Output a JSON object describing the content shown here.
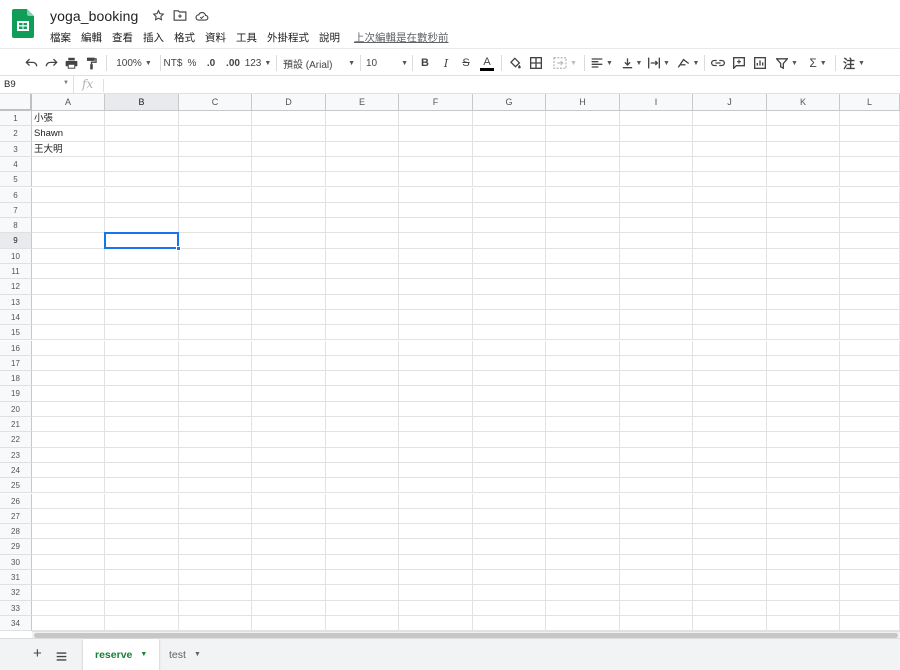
{
  "app": {
    "doc_title": "yoga_booking",
    "brand_color": "#0f9d58",
    "accent_color": "#1a73e8"
  },
  "header": {
    "icons": [
      "star-icon",
      "move-to-folder-icon",
      "cloud-status-icon"
    ],
    "menus": [
      "檔案",
      "編輯",
      "查看",
      "插入",
      "格式",
      "資料",
      "工具",
      "外掛程式",
      "說明"
    ],
    "last_edit": "上次編輯是在數秒前"
  },
  "toolbar": {
    "zoom": "100%",
    "currency": "NT$",
    "percent": "%",
    "decrease_decimal": ".0",
    "increase_decimal": ".00",
    "more_formats": "123",
    "font": "預設 (Arial)",
    "font_size": "10",
    "bold": "B",
    "italic": "I",
    "strike": "S",
    "text_color": "A",
    "sum": "Σ",
    "input_tools": "注"
  },
  "formula_bar": {
    "name_box": "B9",
    "fx": "fx",
    "value": ""
  },
  "grid": {
    "columns": [
      "A",
      "B",
      "C",
      "D",
      "E",
      "F",
      "G",
      "H",
      "I",
      "J",
      "K",
      "L"
    ],
    "row_count": 34,
    "active_cell": "B9",
    "cells": {
      "A1": "小張",
      "A2": "Shawn",
      "A3": "王大明"
    }
  },
  "sheets": {
    "tabs": [
      "reserve",
      "test"
    ],
    "active": "reserve",
    "active_color": "#188038"
  }
}
